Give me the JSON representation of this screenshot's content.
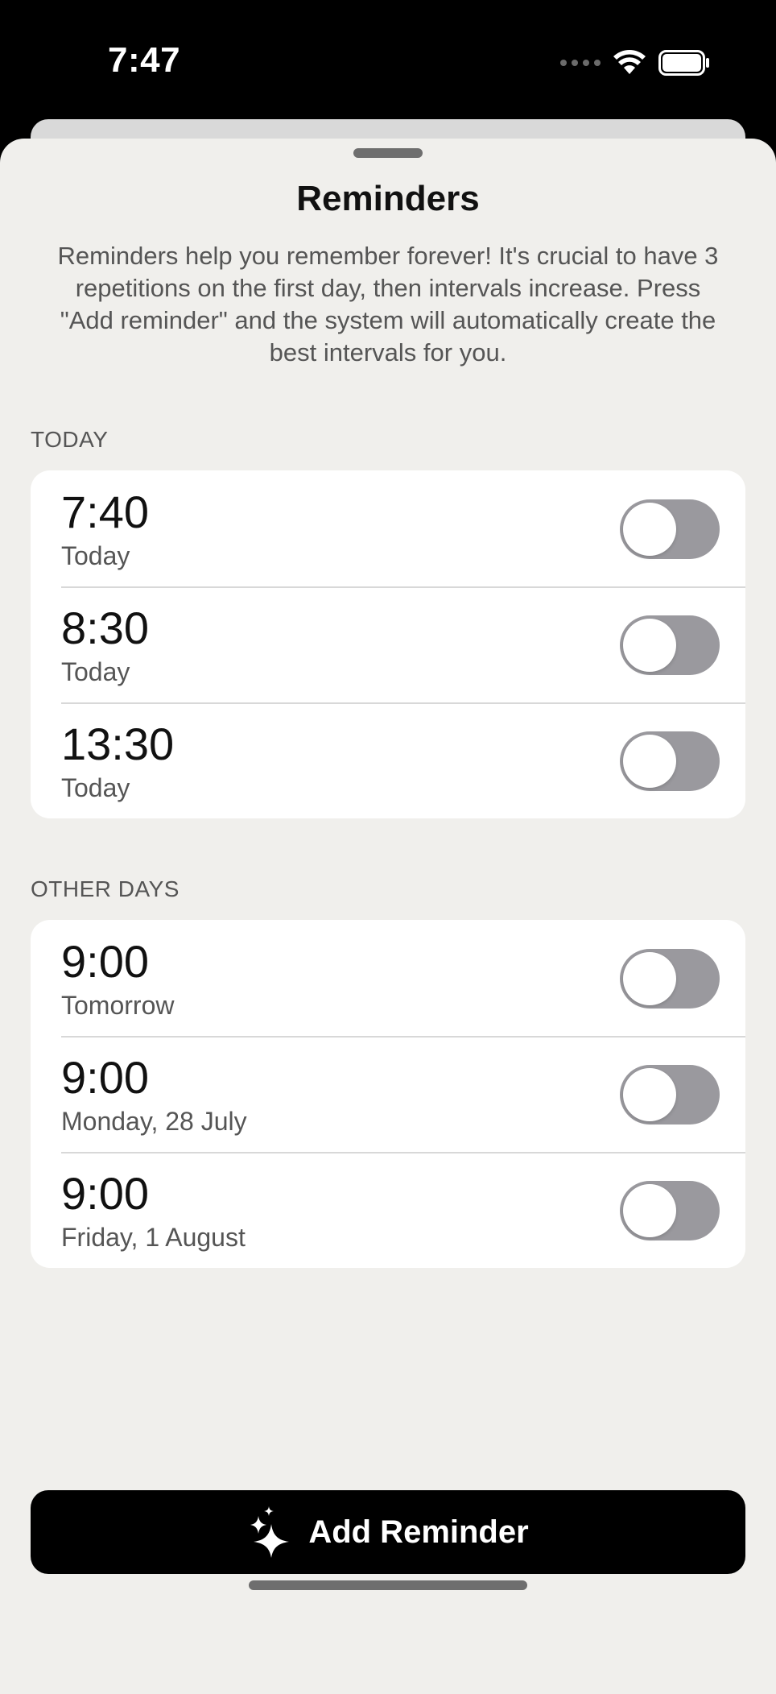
{
  "status_bar": {
    "time": "7:47",
    "icons": [
      "signal-dots-icon",
      "wifi-icon",
      "battery-icon"
    ]
  },
  "sheet": {
    "title": "Reminders",
    "description": "Reminders help you remember forever! It's crucial to have 3 repetitions on the first day, then intervals increase. Press \"Add reminder\" and the system will automatically create the best intervals for you."
  },
  "sections": {
    "today": {
      "header": "TODAY",
      "items": [
        {
          "time": "7:40",
          "day": "Today",
          "enabled": false
        },
        {
          "time": "8:30",
          "day": "Today",
          "enabled": false
        },
        {
          "time": "13:30",
          "day": "Today",
          "enabled": false
        }
      ]
    },
    "other_days": {
      "header": "OTHER DAYS",
      "items": [
        {
          "time": "9:00",
          "day": "Tomorrow",
          "enabled": false
        },
        {
          "time": "9:00",
          "day": "Monday, 28 July",
          "enabled": false
        },
        {
          "time": "9:00",
          "day": "Friday, 1 August",
          "enabled": false
        }
      ]
    }
  },
  "add_button": {
    "label": "Add Reminder",
    "icon": "sparkle-icon"
  },
  "colors": {
    "sheet_background": "#f0efec",
    "toggle_off": "#9a999e",
    "button_background": "#000000"
  }
}
